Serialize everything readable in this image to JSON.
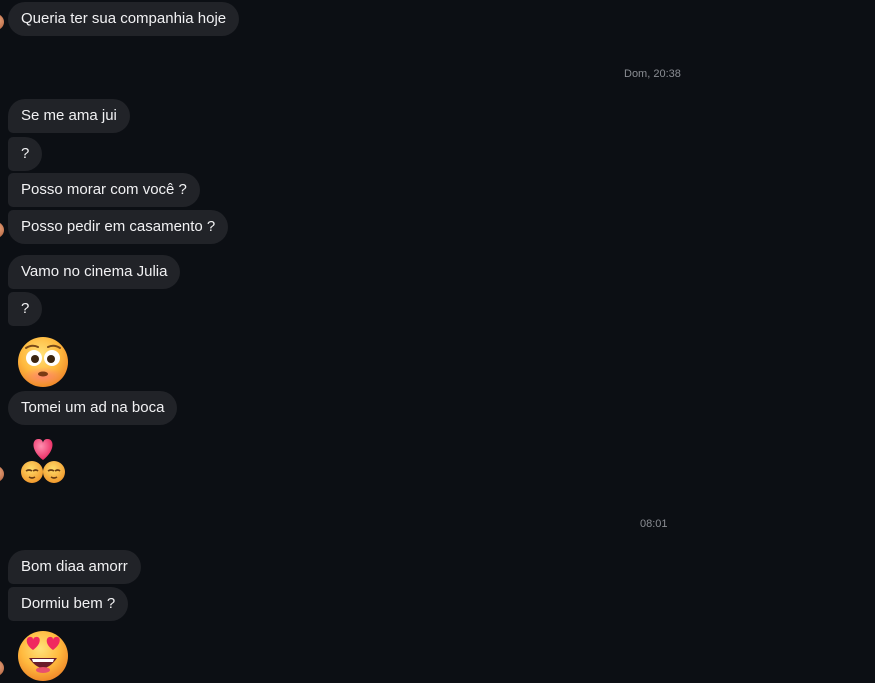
{
  "messages": [
    {
      "text": "Queria ter sua companhia hoje"
    },
    {
      "text": "Se me ama jui"
    },
    {
      "text": "?"
    },
    {
      "text": "Posso morar com você ?"
    },
    {
      "text": "Posso pedir em casamento ?"
    },
    {
      "text": "Vamo no cinema Julia"
    },
    {
      "text": "?"
    },
    {
      "text": "Tomei um ad na boca"
    },
    {
      "text": "Bom diaa amorr"
    },
    {
      "text": "Dormiu bem ?"
    }
  ],
  "timestamps": [
    "Dom, 20:38",
    "08:01"
  ],
  "emojis": [
    "flushed-face",
    "couple-with-heart",
    "heart-eyes-face"
  ]
}
